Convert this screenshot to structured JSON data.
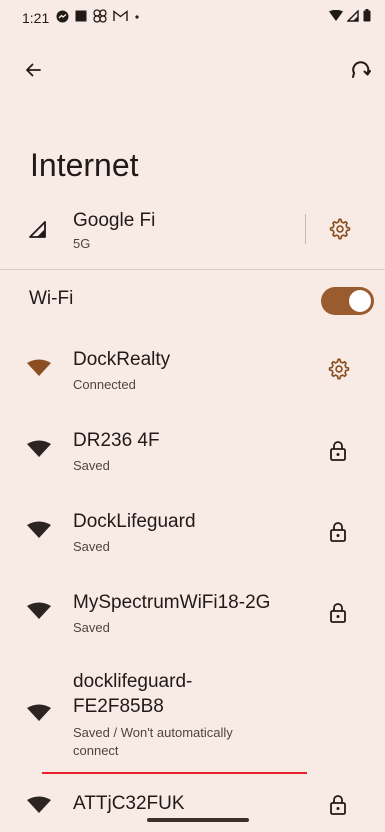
{
  "status_bar": {
    "time": "1:21",
    "left_icons": [
      "messenger-icon",
      "square-icon",
      "fan-icon",
      "gmail-icon",
      "dot-icon"
    ],
    "right_icons": [
      "wifi-signal-icon",
      "cell-signal-icon",
      "battery-icon"
    ]
  },
  "app_bar": {
    "back_icon": "arrow-left-icon",
    "refresh_icon": "refresh-icon"
  },
  "page": {
    "title": "Internet"
  },
  "mobile_network": {
    "name": "Google Fi",
    "sub": "5G",
    "icon": "cell-signal-icon",
    "action_icon": "gear-icon"
  },
  "wifi_toggle": {
    "label": "Wi-Fi",
    "enabled": true,
    "accent": "#9a5b2e"
  },
  "networks": [
    {
      "name": "DockRealty",
      "status": "Connected",
      "action_icon": "gear-icon",
      "connected": true
    },
    {
      "name": "DR236 4F",
      "status": "Saved",
      "action_icon": "lock-icon",
      "connected": false
    },
    {
      "name": "DockLifeguard",
      "status": "Saved",
      "action_icon": "lock-icon",
      "connected": false
    },
    {
      "name": "MySpectrumWiFi18-2G",
      "status": "Saved",
      "action_icon": "lock-icon",
      "connected": false
    },
    {
      "name_line1": "docklifeguard-",
      "name_line2": "FE2F85B8",
      "status_line1": "Saved / Won't automatically",
      "status_line2": "connect",
      "connected": false
    },
    {
      "name": "ATTjC32FUK",
      "action_icon": "lock-icon",
      "connected": false
    }
  ],
  "colors": {
    "background": "#f8ebe6",
    "connected_wifi": "#8a4f22",
    "wifi_icon": "#2b2420",
    "gear": "#8a4f22",
    "highlight_line": "#e8212c"
  }
}
